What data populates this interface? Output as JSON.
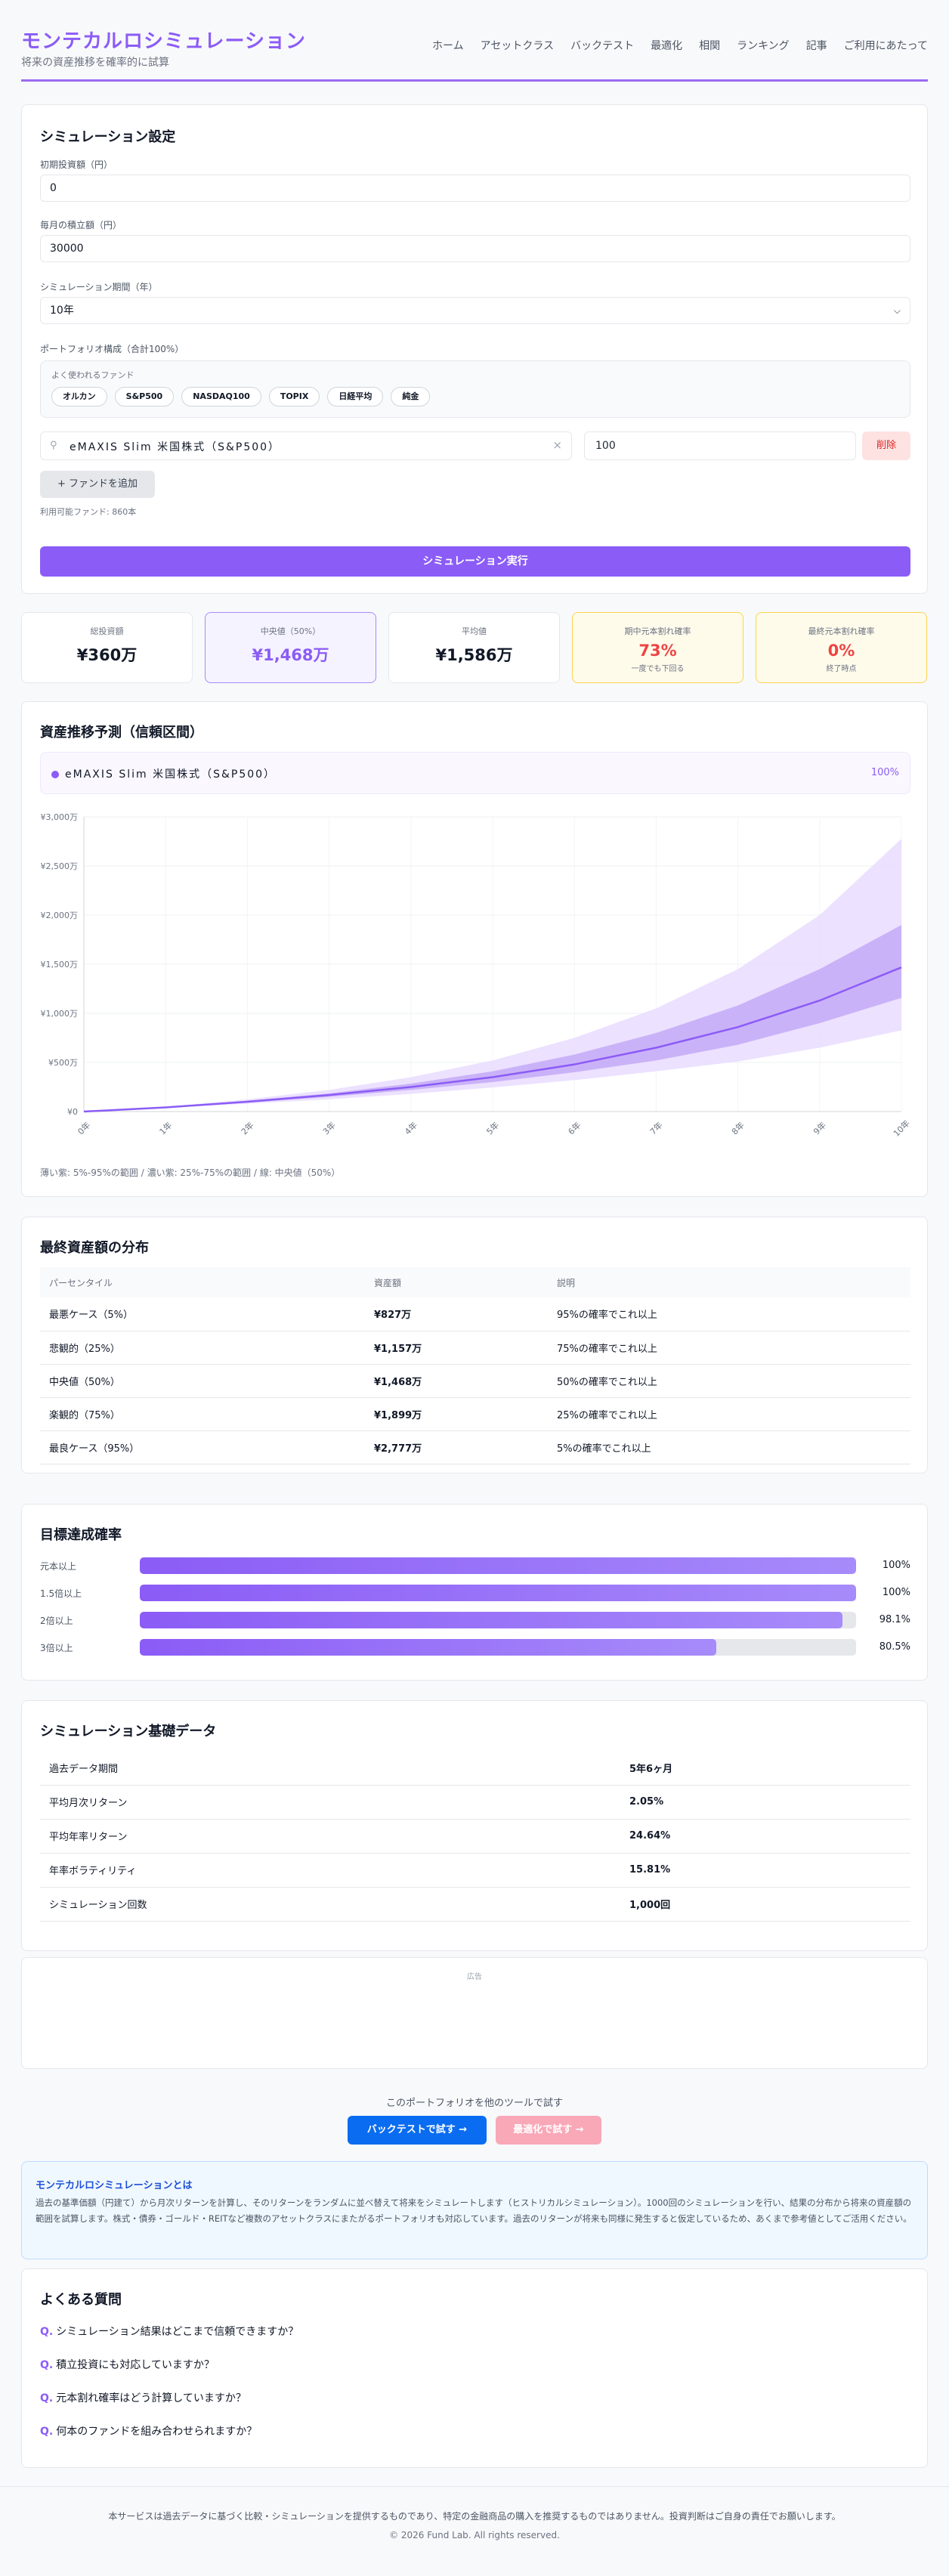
{
  "header": {
    "title": "モンテカルロシミュレーション",
    "subtitle": "将来の資産推移を確率的に試算",
    "nav": [
      "ホーム",
      "アセットクラス",
      "バックテスト",
      "最適化",
      "相関",
      "ランキング",
      "記事",
      "ご利用にあたって"
    ]
  },
  "settings": {
    "title": "シミュレーション設定",
    "initial_label": "初期投資額（円）",
    "initial_value": "0",
    "monthly_label": "毎月の積立額（円）",
    "monthly_value": "30000",
    "period_label": "シミュレーション期間（年）",
    "period_value": "10年",
    "portfolio_label": "ポートフォリオ構成（合計100%）",
    "fav_title": "よく使われるファンド",
    "fav_funds": [
      "オルカン",
      "S&P500",
      "NASDAQ100",
      "TOPIX",
      "日経平均",
      "純金"
    ],
    "fund_name": "eMAXIS Slim 米国株式（S&P500）",
    "fund_weight": "100",
    "delete_label": "削除",
    "add_fund_label": "+ ファンドを追加",
    "available_funds": "利用可能ファンド: 860本",
    "run_label": "シミュレーション実行"
  },
  "stats": [
    {
      "label": "総投資額",
      "value": "¥360万",
      "sub": ""
    },
    {
      "label": "中央値（50%）",
      "value": "¥1,468万",
      "sub": ""
    },
    {
      "label": "平均値",
      "value": "¥1,586万",
      "sub": ""
    },
    {
      "label": "期中元本割れ確率",
      "value": "73%",
      "sub": "一度でも下回る"
    },
    {
      "label": "最終元本割れ確率",
      "value": "0%",
      "sub": "終了時点"
    }
  ],
  "chart_section": {
    "title": "資産推移予測（信頼区間）",
    "legend_name": "eMAXIS Slim 米国株式（S&P500）",
    "legend_pct": "100%",
    "note": "薄い紫: 5%-95%の範囲 / 濃い紫: 25%-75%の範囲 / 線: 中央値（50%）"
  },
  "chart_data": {
    "type": "area",
    "x": [
      0,
      1,
      2,
      3,
      4,
      5,
      6,
      7,
      8,
      9,
      10
    ],
    "x_tick_labels": [
      "0年",
      "1年",
      "2年",
      "3年",
      "4年",
      "5年",
      "6年",
      "7年",
      "8年",
      "9年",
      "10年"
    ],
    "y_tick_labels": [
      "¥0",
      "¥500万",
      "¥1,000万",
      "¥1,500万",
      "¥2,000万",
      "¥2,500万",
      "¥3,000万"
    ],
    "ylim": [
      0,
      3000
    ],
    "grid": true,
    "series": [
      {
        "values": [
          0,
          38,
          80,
          125,
          180,
          245,
          320,
          410,
          510,
          650,
          827
        ]
      },
      {
        "values": [
          0,
          40,
          90,
          150,
          220,
          300,
          400,
          520,
          680,
          900,
          1157
        ]
      },
      {
        "values": [
          0,
          42,
          100,
          168,
          250,
          350,
          480,
          650,
          860,
          1130,
          1468
        ]
      },
      {
        "values": [
          0,
          44,
          110,
          185,
          285,
          410,
          580,
          800,
          1080,
          1450,
          1899
        ]
      },
      {
        "values": [
          0,
          48,
          125,
          220,
          350,
          520,
          750,
          1050,
          1450,
          2000,
          2777
        ]
      }
    ],
    "colors": {
      "outer_band": "#e9dcff",
      "inner_band": "#c4a9f7",
      "median": "#8b5cf6"
    }
  },
  "distribution": {
    "title": "最終資産額の分布",
    "headers": [
      "パーセンタイル",
      "資産額",
      "説明"
    ],
    "rows": [
      [
        "最悪ケース（5%）",
        "¥827万",
        "95%の確率でこれ以上"
      ],
      [
        "悲観的（25%）",
        "¥1,157万",
        "75%の確率でこれ以上"
      ],
      [
        "中央値（50%）",
        "¥1,468万",
        "50%の確率でこれ以上"
      ],
      [
        "楽観的（75%）",
        "¥1,899万",
        "25%の確率でこれ以上"
      ],
      [
        "最良ケース（95%）",
        "¥2,777万",
        "5%の確率でこれ以上"
      ]
    ]
  },
  "goals": {
    "title": "目標達成確率",
    "items": [
      {
        "label": "元本以上",
        "value": "100%",
        "pct": 100
      },
      {
        "label": "1.5倍以上",
        "value": "100%",
        "pct": 100
      },
      {
        "label": "2倍以上",
        "value": "98.1%",
        "pct": 98.1
      },
      {
        "label": "3倍以上",
        "value": "80.5%",
        "pct": 80.5
      }
    ]
  },
  "base_data": {
    "title": "シミュレーション基礎データ",
    "rows": [
      [
        "過去データ期間",
        "5年6ヶ月"
      ],
      [
        "平均月次リターン",
        "2.05%"
      ],
      [
        "平均年率リターン",
        "24.64%"
      ],
      [
        "年率ボラティリティ",
        "15.81%"
      ],
      [
        "シミュレーション回数",
        "1,000回"
      ]
    ]
  },
  "ad_label": "広告",
  "other_tools": {
    "text": "このポートフォリオを他のツールで試す",
    "backtest": "バックテストで試す →",
    "optimize": "最適化で試す →"
  },
  "info": {
    "title": "モンテカルロシミュレーションとは",
    "body": "過去の基準価額（円建て）から月次リターンを計算し、そのリターンをランダムに並べ替えて将来をシミュレートします（ヒストリカルシミュレーション）。1000回のシミュレーションを行い、結果の分布から将来の資産額の範囲を試算します。株式・債券・ゴールド・REITなど複数のアセットクラスにまたがるポートフォリオも対応しています。過去のリターンが将来も同様に発生すると仮定しているため、あくまで参考値としてご活用ください。"
  },
  "faq": {
    "title": "よくある質問",
    "items": [
      "シミュレーション結果はどこまで信頼できますか？",
      "積立投資にも対応していますか？",
      "元本割れ確率はどう計算していますか？",
      "何本のファンドを組み合わせられますか？"
    ]
  },
  "footer": {
    "disclaimer": "本サービスは過去データに基づく比較・シミュレーションを提供するものであり、特定の金融商品の購入を推奨するものではありません。投資判断はご自身の責任でお願いします。",
    "copyright": "© 2026 Fund Lab. All rights reserved."
  }
}
